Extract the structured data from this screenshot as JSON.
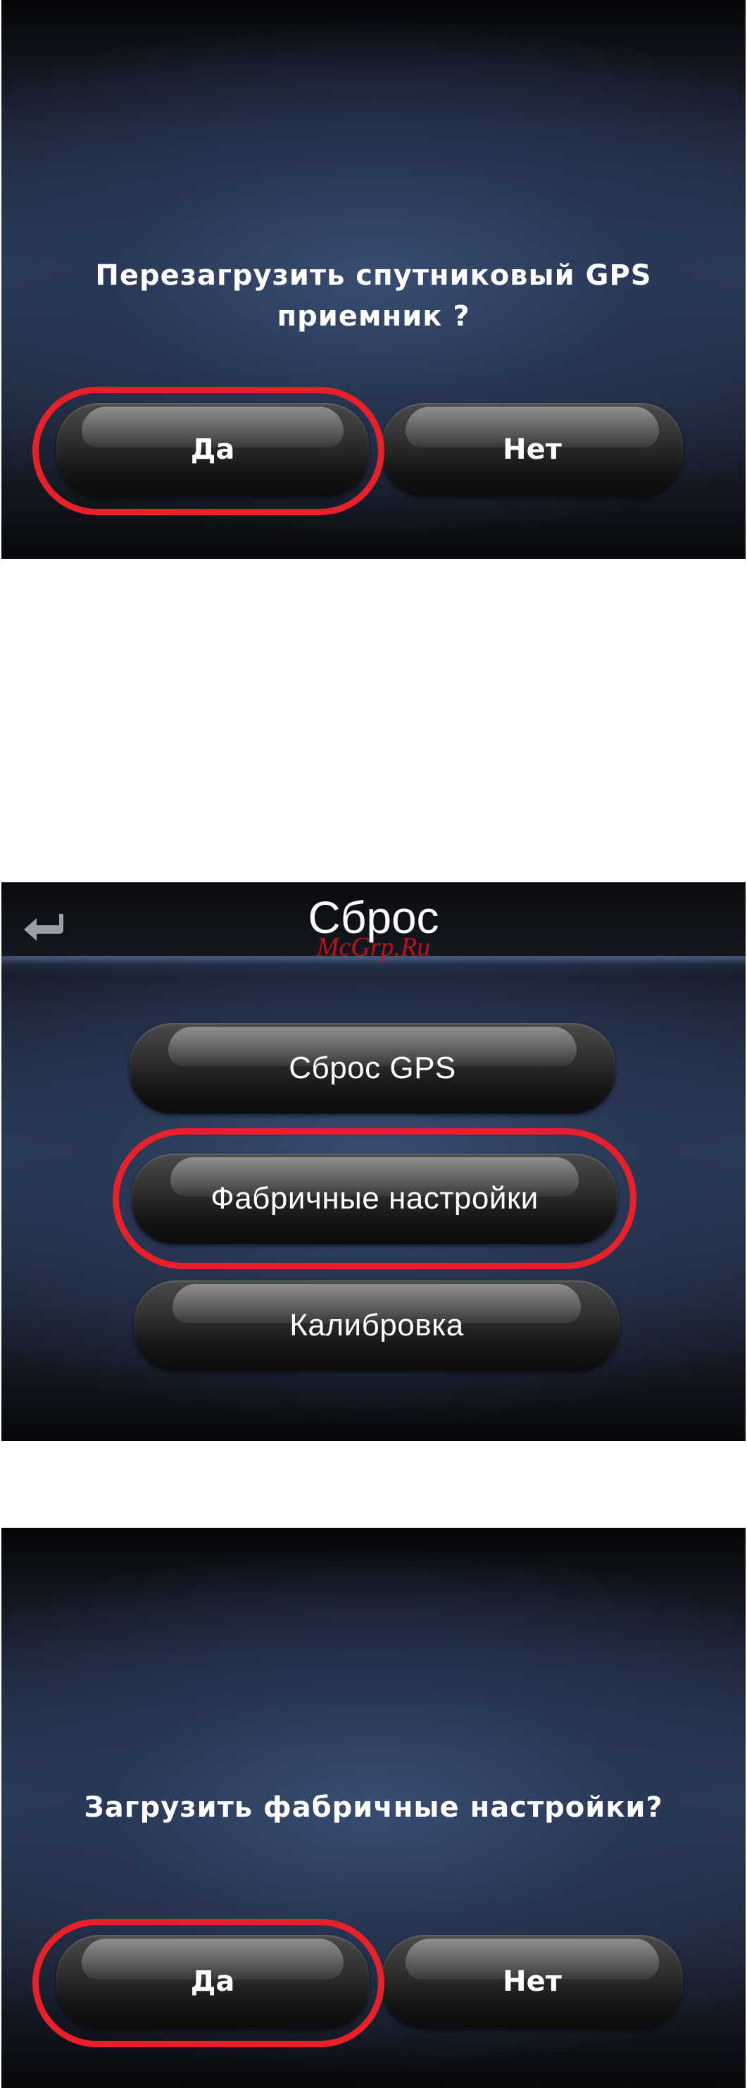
{
  "screen1": {
    "question_line1": "Перезагрузить спутниковый GPS",
    "question_line2": "приемник ?",
    "yes_label": "Да",
    "no_label": "Нет"
  },
  "screen2": {
    "title": "Сброс",
    "watermark": "McGrp.Ru",
    "back_icon": "return-arrow-icon",
    "menu": [
      {
        "label": "Сброс GPS"
      },
      {
        "label": "Фабричные настройки"
      },
      {
        "label": "Калибровка"
      }
    ]
  },
  "screen3": {
    "question": "Загрузить фабричные настройки?",
    "yes_label": "Да",
    "no_label": "Нет"
  },
  "colors": {
    "highlight": "#e8202a",
    "text": "#ffffff",
    "watermark": "#c8141c"
  }
}
